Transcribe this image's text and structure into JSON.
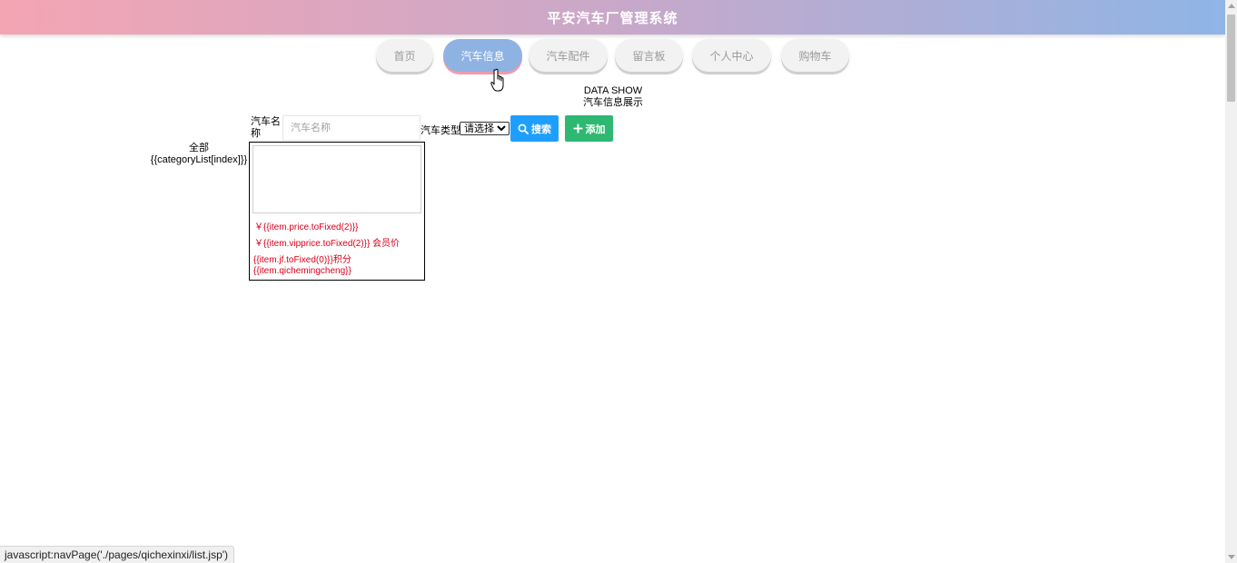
{
  "header": {
    "title": "平安汽车厂管理系统"
  },
  "nav": {
    "items": [
      {
        "label": "首页"
      },
      {
        "label": "汽车信息"
      },
      {
        "label": "汽车配件"
      },
      {
        "label": "留言板"
      },
      {
        "label": "个人中心"
      },
      {
        "label": "购物车"
      }
    ],
    "active_index": 1
  },
  "section": {
    "title_en": "DATA SHOW",
    "title_cn": "汽车信息展示"
  },
  "category_list": {
    "all": "全部",
    "item_template": "{{categoryList[index]}}"
  },
  "search": {
    "name_label": "汽车名称",
    "name_placeholder": "汽车名称",
    "name_value": "",
    "type_label": "汽车类型",
    "type_selected": "请选择",
    "search_button": "搜索",
    "add_button": "添加"
  },
  "card": {
    "price": "￥{{item.price.toFixed(2)}}",
    "vip_price": "￥{{item.vipprice.toFixed(2)}} 会员价",
    "points": "{{item.jf.toFixed(0)}}积分",
    "name": "{{item.qichemingcheng}}"
  },
  "status_bar": {
    "text": "javascript:navPage('./pages/qichexinxi/list.jsp')"
  },
  "colors": {
    "header_gradient_start": "#f4a5b3",
    "header_gradient_end": "#8fb5e6",
    "nav_active": "#8eb3e3",
    "search_button": "#1e9fff",
    "add_button": "#2eb872",
    "card_text": "#d9001b"
  },
  "icons": {
    "search_button_icon": "search-icon",
    "add_button_icon": "plus-icon",
    "cursor": "hand-pointer-icon"
  }
}
